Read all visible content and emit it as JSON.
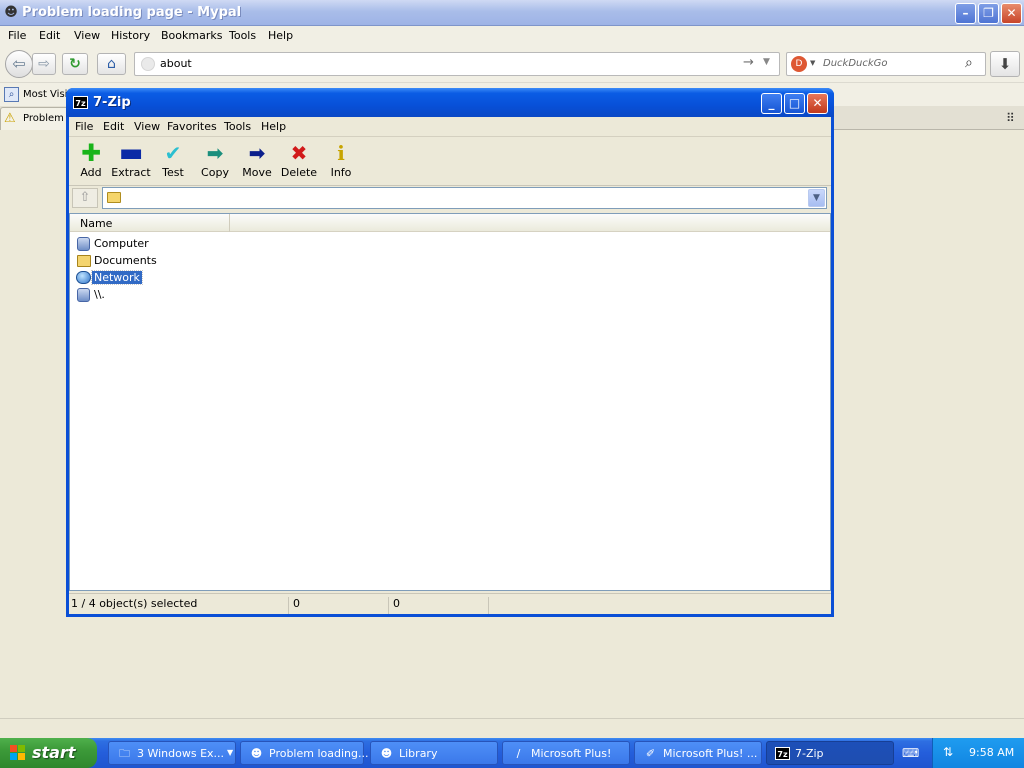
{
  "browser": {
    "title": "Problem loading page - Mypal",
    "menu": [
      "File",
      "Edit",
      "View",
      "History",
      "Bookmarks",
      "Tools",
      "Help"
    ],
    "url": "about",
    "search_placeholder": "DuckDuckGo",
    "bookmark_label": "Most Visit",
    "tab_label": "Problem l"
  },
  "zip": {
    "title": "7-Zip",
    "icon_text": "7z",
    "menu": [
      "File",
      "Edit",
      "View",
      "Favorites",
      "Tools",
      "Help"
    ],
    "toolbar": [
      {
        "label": "Add",
        "icon": "add-icon",
        "color": "#19b419"
      },
      {
        "label": "Extract",
        "icon": "extract-icon",
        "color": "#0b2aa6"
      },
      {
        "label": "Test",
        "icon": "test-icon",
        "color": "#2bbfd0"
      },
      {
        "label": "Copy",
        "icon": "copy-icon",
        "color": "#1b8f7d"
      },
      {
        "label": "Move",
        "icon": "move-icon",
        "color": "#0c1f8c"
      },
      {
        "label": "Delete",
        "icon": "delete-icon",
        "color": "#d11a1a"
      },
      {
        "label": "Info",
        "icon": "info-icon",
        "color": "#c7a400"
      }
    ],
    "address_value": "",
    "column_name": "Name",
    "items": [
      {
        "label": "Computer",
        "icon": "computer-icon",
        "selected": false
      },
      {
        "label": "Documents",
        "icon": "folder-icon",
        "selected": false
      },
      {
        "label": "Network",
        "icon": "network-icon",
        "selected": true
      },
      {
        "label": "\\\\.",
        "icon": "computer-icon",
        "selected": false
      }
    ],
    "status": {
      "selection": "1 / 4 object(s) selected",
      "size": "0",
      "packed": "0"
    }
  },
  "taskbar": {
    "start_label": "start",
    "tasks": [
      {
        "label": "3 Windows Ex...",
        "icon": "folder-icon",
        "active": false
      },
      {
        "label": "Problem loading...",
        "icon": "mypal-icon",
        "active": false
      },
      {
        "label": "Library",
        "icon": "mypal-icon",
        "active": false
      },
      {
        "label": "Microsoft Plus!",
        "icon": "plus-icon",
        "active": false
      },
      {
        "label": "Microsoft Plus! ...",
        "icon": "plus-icon",
        "active": false
      },
      {
        "label": "7-Zip",
        "icon": "7zip-icon",
        "active": true
      }
    ],
    "clock": "9:58 AM"
  },
  "colors": {
    "xp_blue": "#245edb",
    "selection": "#316ac5",
    "start_green": "#3c9a39"
  }
}
